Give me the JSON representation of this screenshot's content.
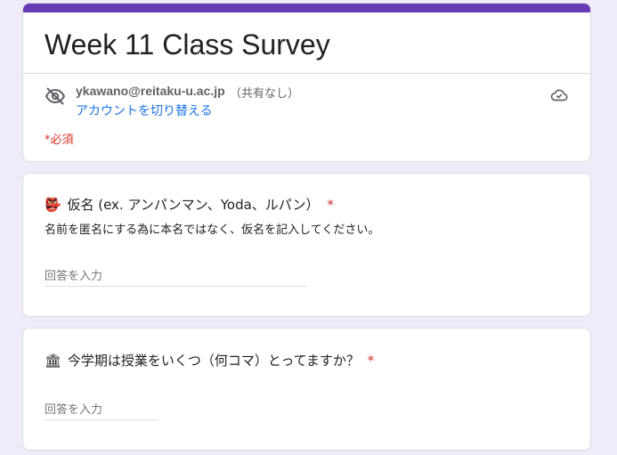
{
  "form": {
    "title": "Week 11 Class Survey",
    "account_email": "ykawano@reitaku-u.ac.jp",
    "not_shared": "（共有なし）",
    "switch_account": "アカウントを切り替える",
    "required_note": "*必須",
    "accent_color": "#673ab7"
  },
  "questions": [
    {
      "emoji": "👺",
      "title": "仮名 (ex. アンパンマン、Yoda、ルパン）",
      "required_mark": "*",
      "description": "名前を匿名にする為に本名ではなく、仮名を記入してください。",
      "placeholder": "回答を入力"
    },
    {
      "emoji": "🏛",
      "title": "今学期は授業をいくつ（何コマ）とってますか？",
      "required_mark": "*",
      "placeholder": "回答を入力"
    }
  ],
  "icons": {
    "visibility": "eye-off-icon",
    "cloud": "cloud-saved-icon"
  }
}
